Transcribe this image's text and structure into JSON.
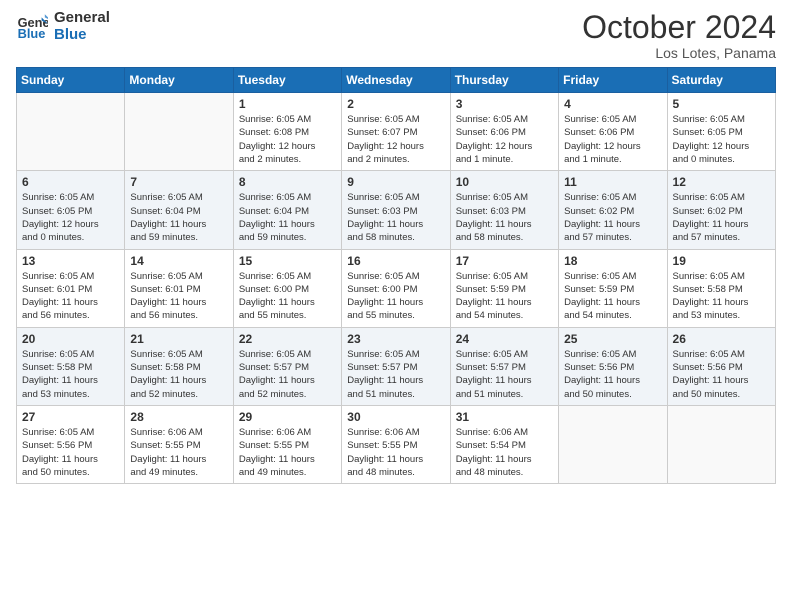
{
  "logo": {
    "line1": "General",
    "line2": "Blue"
  },
  "title": "October 2024",
  "subtitle": "Los Lotes, Panama",
  "weekdays": [
    "Sunday",
    "Monday",
    "Tuesday",
    "Wednesday",
    "Thursday",
    "Friday",
    "Saturday"
  ],
  "weeks": [
    [
      {
        "day": "",
        "info": ""
      },
      {
        "day": "",
        "info": ""
      },
      {
        "day": "1",
        "info": "Sunrise: 6:05 AM\nSunset: 6:08 PM\nDaylight: 12 hours\nand 2 minutes."
      },
      {
        "day": "2",
        "info": "Sunrise: 6:05 AM\nSunset: 6:07 PM\nDaylight: 12 hours\nand 2 minutes."
      },
      {
        "day": "3",
        "info": "Sunrise: 6:05 AM\nSunset: 6:06 PM\nDaylight: 12 hours\nand 1 minute."
      },
      {
        "day": "4",
        "info": "Sunrise: 6:05 AM\nSunset: 6:06 PM\nDaylight: 12 hours\nand 1 minute."
      },
      {
        "day": "5",
        "info": "Sunrise: 6:05 AM\nSunset: 6:05 PM\nDaylight: 12 hours\nand 0 minutes."
      }
    ],
    [
      {
        "day": "6",
        "info": "Sunrise: 6:05 AM\nSunset: 6:05 PM\nDaylight: 12 hours\nand 0 minutes."
      },
      {
        "day": "7",
        "info": "Sunrise: 6:05 AM\nSunset: 6:04 PM\nDaylight: 11 hours\nand 59 minutes."
      },
      {
        "day": "8",
        "info": "Sunrise: 6:05 AM\nSunset: 6:04 PM\nDaylight: 11 hours\nand 59 minutes."
      },
      {
        "day": "9",
        "info": "Sunrise: 6:05 AM\nSunset: 6:03 PM\nDaylight: 11 hours\nand 58 minutes."
      },
      {
        "day": "10",
        "info": "Sunrise: 6:05 AM\nSunset: 6:03 PM\nDaylight: 11 hours\nand 58 minutes."
      },
      {
        "day": "11",
        "info": "Sunrise: 6:05 AM\nSunset: 6:02 PM\nDaylight: 11 hours\nand 57 minutes."
      },
      {
        "day": "12",
        "info": "Sunrise: 6:05 AM\nSunset: 6:02 PM\nDaylight: 11 hours\nand 57 minutes."
      }
    ],
    [
      {
        "day": "13",
        "info": "Sunrise: 6:05 AM\nSunset: 6:01 PM\nDaylight: 11 hours\nand 56 minutes."
      },
      {
        "day": "14",
        "info": "Sunrise: 6:05 AM\nSunset: 6:01 PM\nDaylight: 11 hours\nand 56 minutes."
      },
      {
        "day": "15",
        "info": "Sunrise: 6:05 AM\nSunset: 6:00 PM\nDaylight: 11 hours\nand 55 minutes."
      },
      {
        "day": "16",
        "info": "Sunrise: 6:05 AM\nSunset: 6:00 PM\nDaylight: 11 hours\nand 55 minutes."
      },
      {
        "day": "17",
        "info": "Sunrise: 6:05 AM\nSunset: 5:59 PM\nDaylight: 11 hours\nand 54 minutes."
      },
      {
        "day": "18",
        "info": "Sunrise: 6:05 AM\nSunset: 5:59 PM\nDaylight: 11 hours\nand 54 minutes."
      },
      {
        "day": "19",
        "info": "Sunrise: 6:05 AM\nSunset: 5:58 PM\nDaylight: 11 hours\nand 53 minutes."
      }
    ],
    [
      {
        "day": "20",
        "info": "Sunrise: 6:05 AM\nSunset: 5:58 PM\nDaylight: 11 hours\nand 53 minutes."
      },
      {
        "day": "21",
        "info": "Sunrise: 6:05 AM\nSunset: 5:58 PM\nDaylight: 11 hours\nand 52 minutes."
      },
      {
        "day": "22",
        "info": "Sunrise: 6:05 AM\nSunset: 5:57 PM\nDaylight: 11 hours\nand 52 minutes."
      },
      {
        "day": "23",
        "info": "Sunrise: 6:05 AM\nSunset: 5:57 PM\nDaylight: 11 hours\nand 51 minutes."
      },
      {
        "day": "24",
        "info": "Sunrise: 6:05 AM\nSunset: 5:57 PM\nDaylight: 11 hours\nand 51 minutes."
      },
      {
        "day": "25",
        "info": "Sunrise: 6:05 AM\nSunset: 5:56 PM\nDaylight: 11 hours\nand 50 minutes."
      },
      {
        "day": "26",
        "info": "Sunrise: 6:05 AM\nSunset: 5:56 PM\nDaylight: 11 hours\nand 50 minutes."
      }
    ],
    [
      {
        "day": "27",
        "info": "Sunrise: 6:05 AM\nSunset: 5:56 PM\nDaylight: 11 hours\nand 50 minutes."
      },
      {
        "day": "28",
        "info": "Sunrise: 6:06 AM\nSunset: 5:55 PM\nDaylight: 11 hours\nand 49 minutes."
      },
      {
        "day": "29",
        "info": "Sunrise: 6:06 AM\nSunset: 5:55 PM\nDaylight: 11 hours\nand 49 minutes."
      },
      {
        "day": "30",
        "info": "Sunrise: 6:06 AM\nSunset: 5:55 PM\nDaylight: 11 hours\nand 48 minutes."
      },
      {
        "day": "31",
        "info": "Sunrise: 6:06 AM\nSunset: 5:54 PM\nDaylight: 11 hours\nand 48 minutes."
      },
      {
        "day": "",
        "info": ""
      },
      {
        "day": "",
        "info": ""
      }
    ]
  ]
}
